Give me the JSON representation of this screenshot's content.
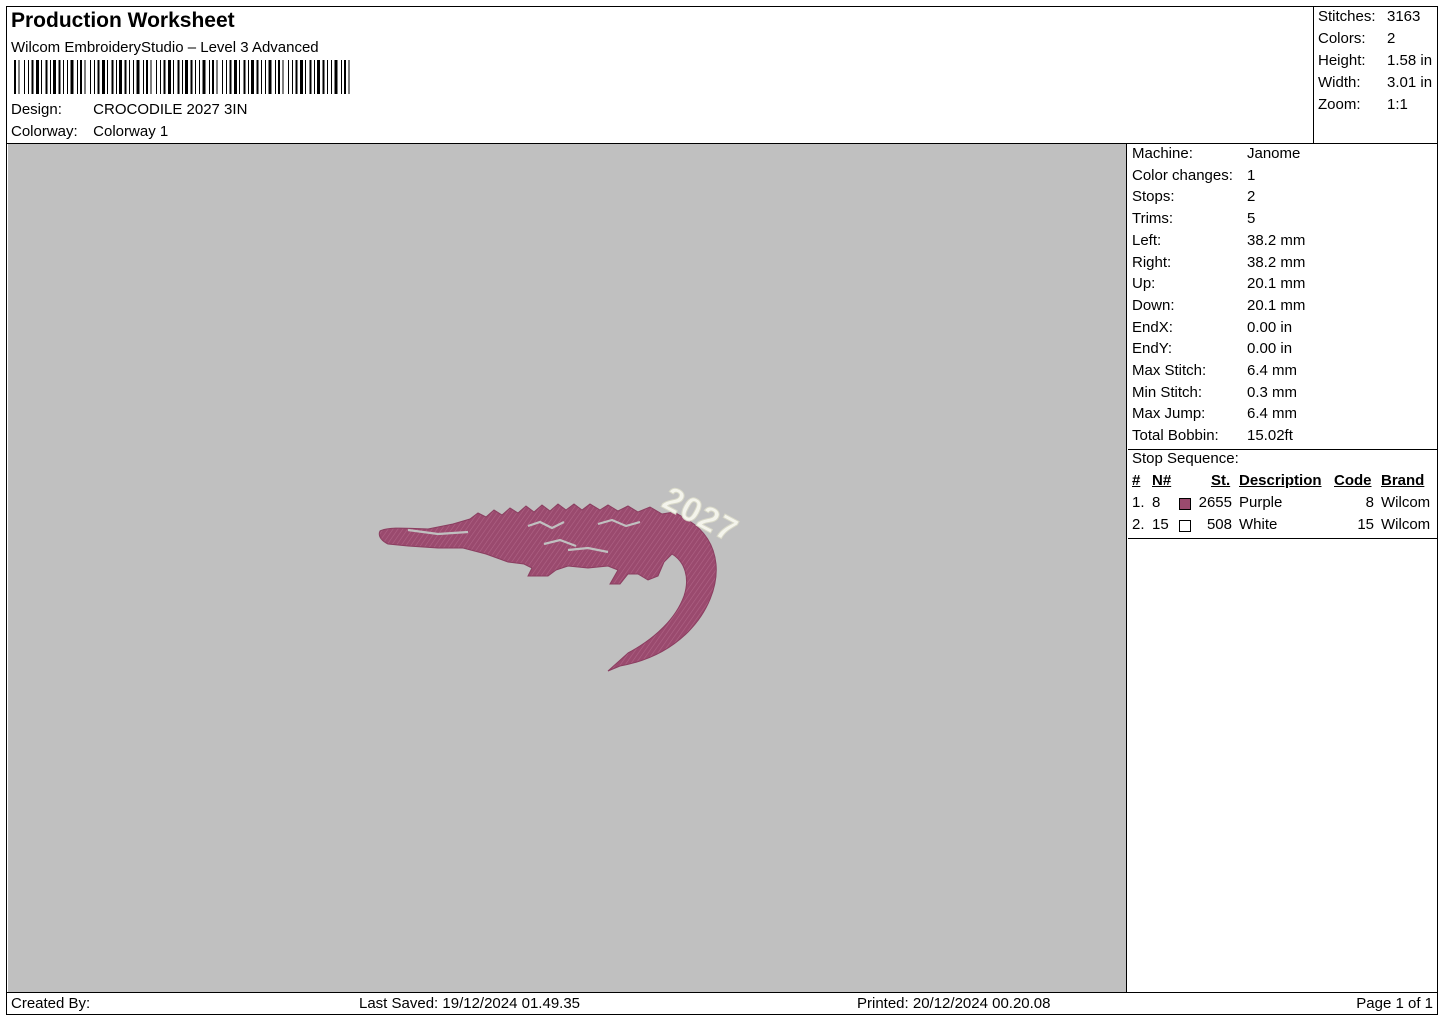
{
  "header": {
    "title": "Production Worksheet",
    "subtitle": "Wilcom EmbroideryStudio – Level 3 Advanced",
    "design_label": "Design:",
    "design_value": "CROCODILE 2027 3IN",
    "colorway_label": "Colorway:",
    "colorway_value": "Colorway 1"
  },
  "summary": [
    {
      "label": "Stitches:",
      "value": "3163"
    },
    {
      "label": "Colors:",
      "value": "2"
    },
    {
      "label": "Height:",
      "value": "1.58 in"
    },
    {
      "label": "Width:",
      "value": "3.01 in"
    },
    {
      "label": "Zoom:",
      "value": "1:1"
    }
  ],
  "properties": [
    {
      "label": "Machine:",
      "value": "Janome"
    },
    {
      "label": "Color changes:",
      "value": "1"
    },
    {
      "label": "Stops:",
      "value": "2"
    },
    {
      "label": "Trims:",
      "value": "5"
    },
    {
      "label": "Left:",
      "value": "38.2 mm"
    },
    {
      "label": "Right:",
      "value": "38.2 mm"
    },
    {
      "label": "Up:",
      "value": "20.1 mm"
    },
    {
      "label": "Down:",
      "value": "20.1 mm"
    },
    {
      "label": "EndX:",
      "value": "0.00 in"
    },
    {
      "label": "EndY:",
      "value": "0.00 in"
    },
    {
      "label": "Max Stitch:",
      "value": "6.4 mm"
    },
    {
      "label": "Min Stitch:",
      "value": "0.3 mm"
    },
    {
      "label": "Max Jump:",
      "value": "6.4 mm"
    },
    {
      "label": "Total Bobbin:",
      "value": "15.02ft"
    }
  ],
  "stop_sequence": {
    "title": "Stop Sequence:",
    "headers": {
      "num": "#",
      "n": "N#",
      "st": "St.",
      "description": "Description",
      "code": "Code",
      "brand": "Brand"
    },
    "rows": [
      {
        "num": "1.",
        "n": "8",
        "color": "#9a4a6e",
        "st": "2655",
        "description": "Purple",
        "code": "8",
        "brand": "Wilcom"
      },
      {
        "num": "2.",
        "n": "15",
        "color": "#ffffff",
        "st": "508",
        "description": "White",
        "code": "15",
        "brand": "Wilcom"
      }
    ]
  },
  "design_preview": {
    "text": "2027",
    "colors": {
      "background": "#c0c0c0",
      "body": "#9a4a6e",
      "text_fill": "#f4f4ec",
      "text_outline": "#d8d8c8"
    }
  },
  "footer": {
    "created_by": "Created By:",
    "last_saved": "Last Saved: 19/12/2024 01.49.35",
    "printed": "Printed: 20/12/2024 00.20.08",
    "page": "Page 1 of 1"
  }
}
